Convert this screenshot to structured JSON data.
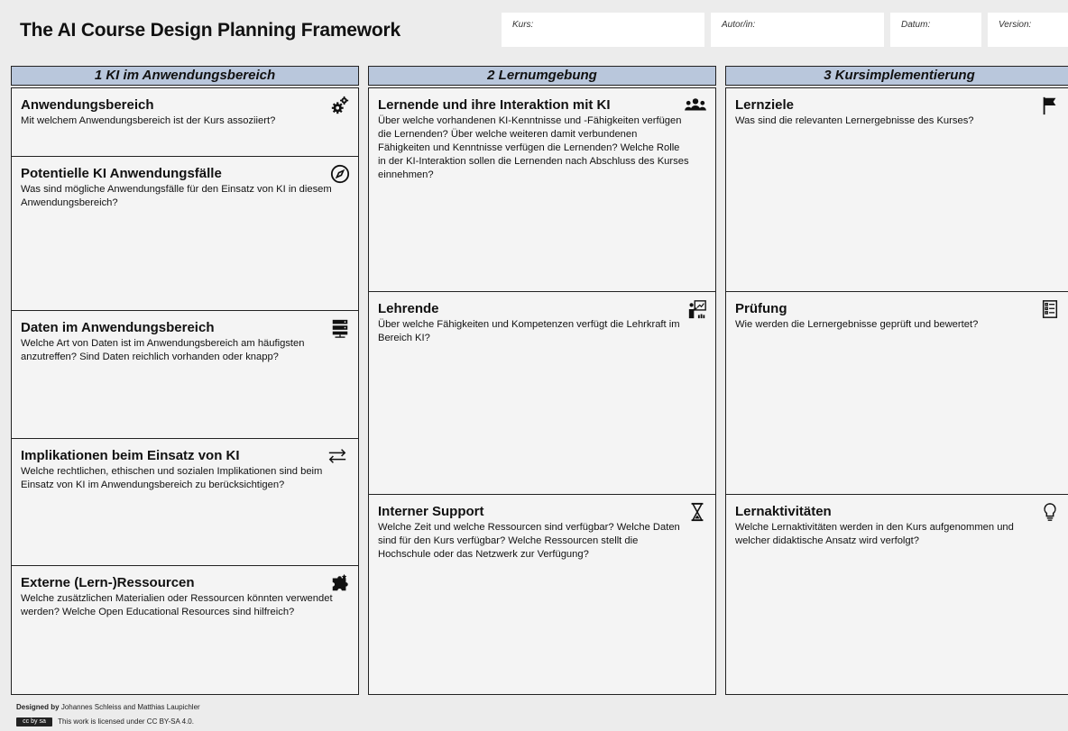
{
  "title": "The AI Course Design Planning Framework",
  "meta": {
    "kurs": "Kurs:",
    "autor": "Autor/in:",
    "datum": "Datum:",
    "version": "Version:"
  },
  "columns": [
    {
      "header": "1 KI im Anwendungsbereich",
      "cells": [
        {
          "title": "Anwendungsbereich",
          "text": "Mit welchem Anwendungsbereich ist der Kurs assoziiert?",
          "icon": "gears-icon"
        },
        {
          "title": "Potentielle KI Anwendungsfälle",
          "text": "Was sind mögliche Anwendungsfälle für den Einsatz von KI in diesem Anwendungsbereich?",
          "icon": "compass-icon"
        },
        {
          "title": "Daten im Anwendungsbereich",
          "text": "Welche Art von Daten ist im Anwendungsbereich am häufigsten anzutreffen? Sind Daten reichlich vorhanden oder knapp?",
          "icon": "server-icon"
        },
        {
          "title": "Implikationen beim Einsatz von KI",
          "text": "Welche rechtlichen, ethischen und sozialen Implikationen sind beim Einsatz von KI im Anwendungsbereich zu berücksichtigen?",
          "icon": "exchange-arrows-icon"
        },
        {
          "title": "Externe (Lern-)Ressourcen",
          "text": "Welche zusätzlichen Materialien oder Ressourcen könnten verwendet werden? Welche Open Educational Resources sind hilfreich?",
          "icon": "puzzle-icon"
        }
      ]
    },
    {
      "header": "2 Lernumgebung",
      "cells": [
        {
          "title": "Lernende und ihre Interaktion mit KI",
          "text": "Über welche vorhandenen KI-Kenntnisse und -Fähigkeiten verfügen die Lernenden? Über welche weiteren damit verbundenen Fähigkeiten und Kenntnisse verfügen die Lernenden? Welche Rolle in der KI-Interaktion sollen die Lernenden nach Abschluss des Kurses einnehmen?",
          "icon": "users-icon"
        },
        {
          "title": "Lehrende",
          "text": "Über welche Fähigkeiten und Kompetenzen verfügt die Lehrkraft im Bereich KI?",
          "icon": "teacher-icon"
        },
        {
          "title": "Interner Support",
          "text": "Welche Zeit und welche Ressourcen sind verfügbar? Welche Daten sind für den Kurs verfügbar? Welche Ressourcen stellt die Hochschule oder das Netzwerk zur Verfügung?",
          "icon": "hourglass-icon"
        }
      ]
    },
    {
      "header": "3 Kursimplementierung",
      "cells": [
        {
          "title": "Lernziele",
          "text": "Was sind die relevanten Lernergebnisse des Kurses?",
          "icon": "flag-icon"
        },
        {
          "title": "Prüfung",
          "text": "Wie werden die Lernergebnisse geprüft und bewertet?",
          "icon": "checklist-icon"
        },
        {
          "title": "Lernaktivitäten",
          "text": "Welche Lernaktivitäten werden in den Kurs aufgenommen und welcher didaktische Ansatz wird verfolgt?",
          "icon": "lightbulb-icon"
        }
      ]
    }
  ],
  "footer": {
    "designed_by_label": "Designed by",
    "designed_by_names": "Johannes Schleiss and Matthias Laupichler",
    "license_badge": "cc by sa",
    "license_text": "This work is licensed under CC BY-SA 4.0."
  }
}
